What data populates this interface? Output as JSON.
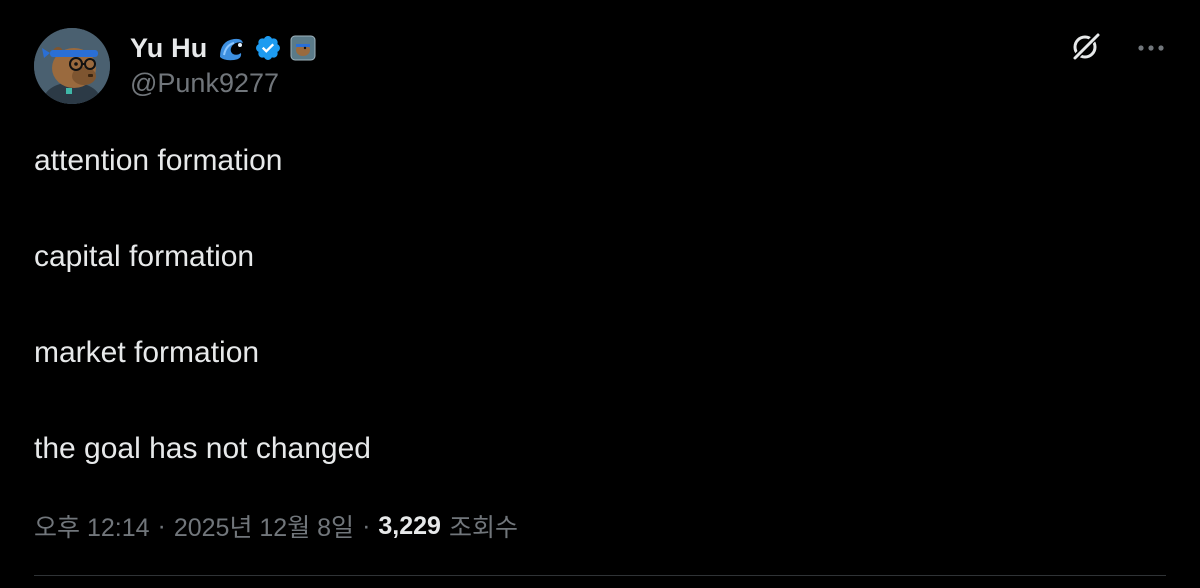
{
  "author": {
    "display_name": "Yu Hu",
    "handle": "@Punk9277",
    "verified": true,
    "badges": [
      "wave-emoji-icon",
      "verified-badge-icon",
      "affiliate-badge-icon"
    ]
  },
  "actions": {
    "grok_icon": "grok-icon",
    "more_icon": "more-options-icon"
  },
  "tweet": {
    "lines": [
      "attention formation",
      "capital formation",
      "market formation",
      "the goal has not changed"
    ]
  },
  "meta": {
    "time": "오후 12:14",
    "separator": "·",
    "date": "2025년 12월 8일",
    "views_count": "3,229",
    "views_label": "조회수"
  },
  "colors": {
    "background": "#000000",
    "primary_text": "#e7e9ea",
    "secondary_text": "#71767b",
    "verified_blue": "#1d9bf0",
    "divider": "#2f3336"
  }
}
